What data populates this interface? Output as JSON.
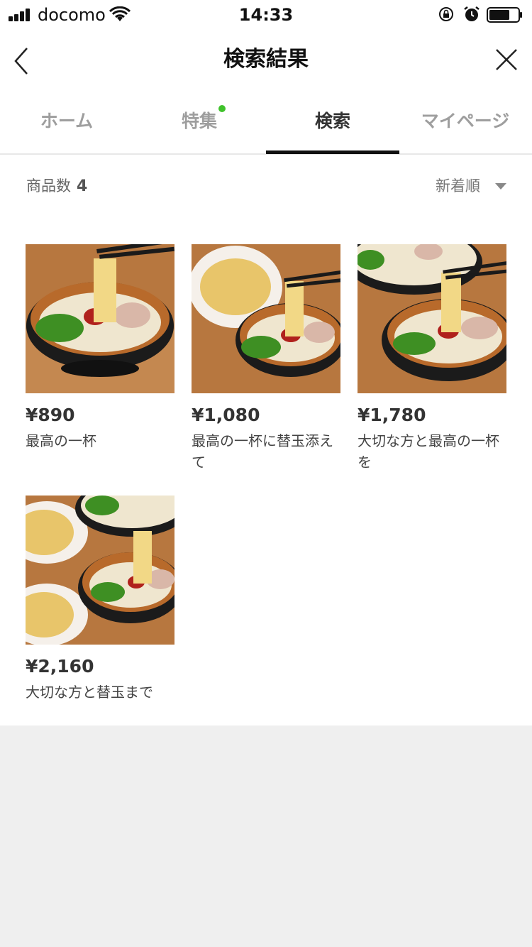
{
  "status_bar": {
    "carrier": "docomo",
    "time": "14:33"
  },
  "header": {
    "title": "検索結果"
  },
  "tabs": [
    {
      "label": "ホーム",
      "active": false
    },
    {
      "label": "特集",
      "active": false,
      "badge_dot": true
    },
    {
      "label": "検索",
      "active": true
    },
    {
      "label": "マイページ",
      "active": false
    }
  ],
  "results": {
    "count_label": "商品数",
    "count_value": "4",
    "sort_label": "新着順"
  },
  "products": [
    {
      "price": "¥890",
      "name": "最高の一杯"
    },
    {
      "price": "¥1,080",
      "name": "最高の一杯に替玉添えて"
    },
    {
      "price": "¥1,780",
      "name": "大切な方と最高の一杯を"
    },
    {
      "price": "¥2,160",
      "name": "大切な方と替玉まで"
    }
  ],
  "colors": {
    "accent_dot": "#3fc22b",
    "active_tab_underline": "#111111",
    "bottom_area": "#efefef"
  }
}
